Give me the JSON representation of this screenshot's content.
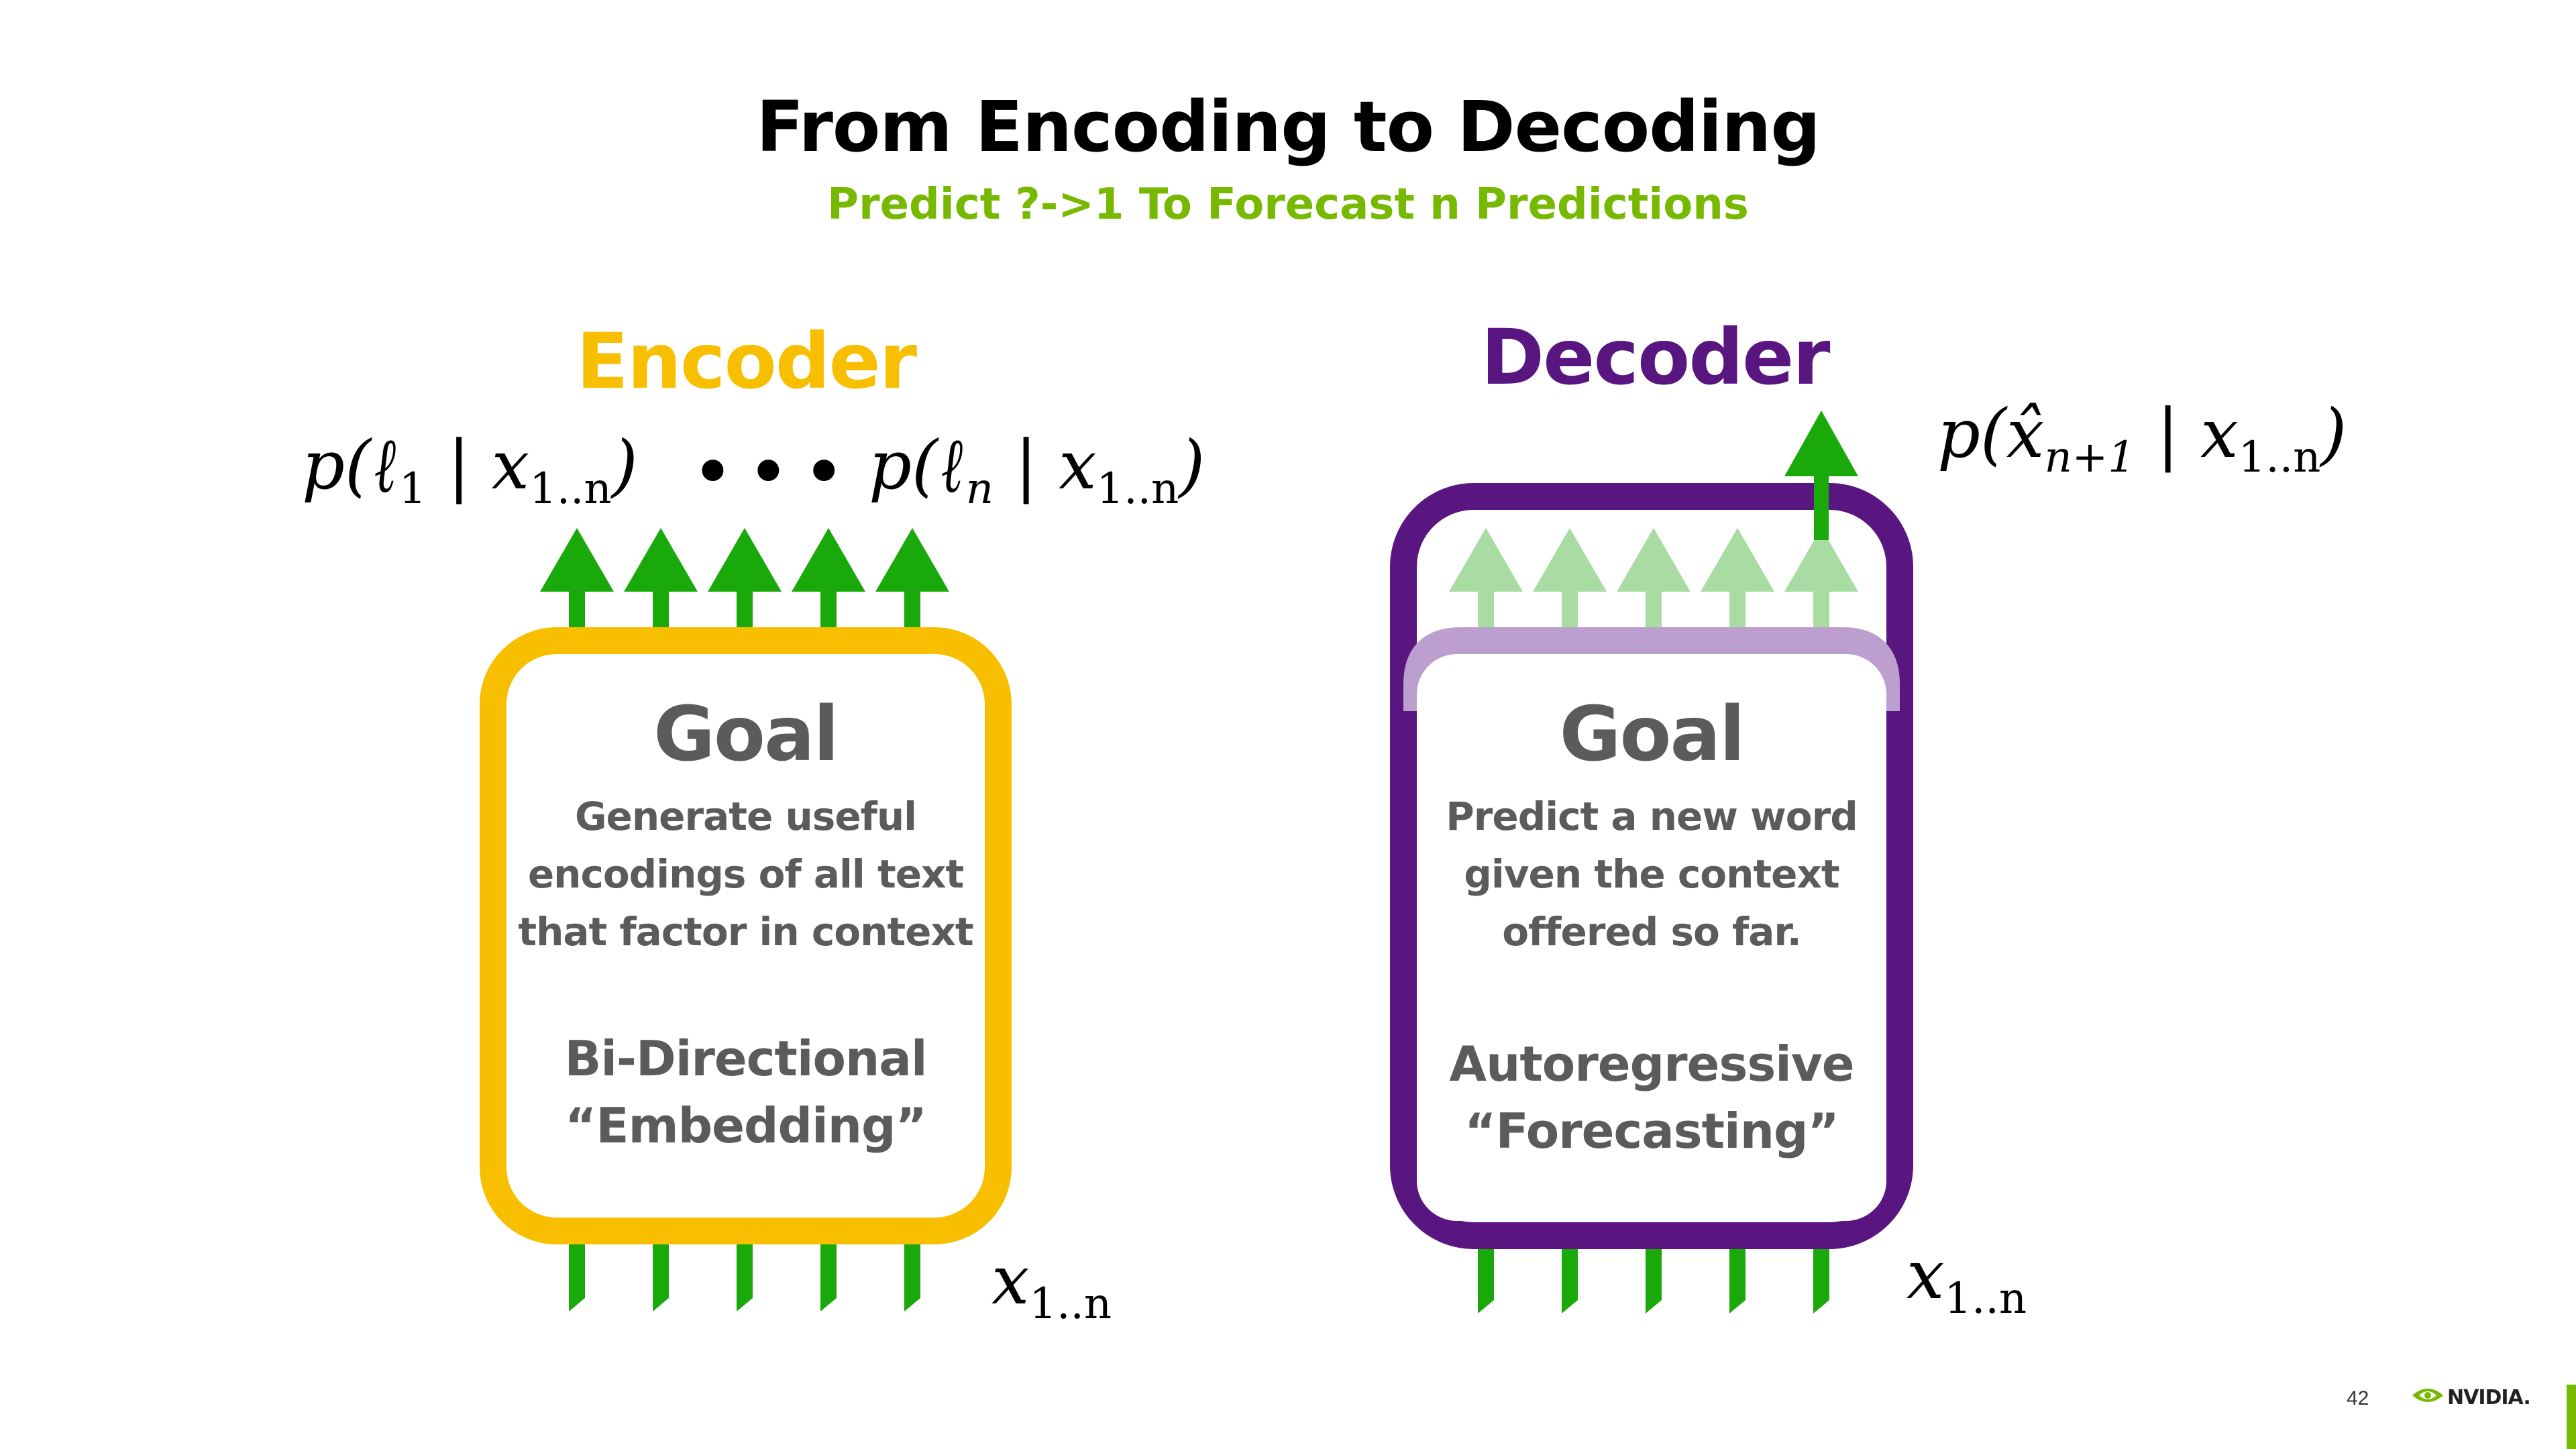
{
  "title": "From Encoding to Decoding",
  "subtitle": "Predict ?->1 To Forecast n Predictions",
  "colors": {
    "encoder": "#f8bf00",
    "decoder": "#5a1680",
    "decoder_inner": "#bd9fcf",
    "arrow": "#1aa90a",
    "arrow_faded": "#a8dca2",
    "text_gray": "#5b5b5b",
    "accent": "#76b900"
  },
  "encoder": {
    "heading": "Encoder",
    "goal": "Goal",
    "description": [
      "Generate useful",
      "encodings of all text",
      "that factor in context"
    ],
    "mode": [
      "Bi-Directional",
      "“Embedding”"
    ],
    "output_first": {
      "p": "p(",
      "sym": "ℓ",
      "sub": "1",
      "bar": " | x",
      "xsub": "1..n",
      "close": ")"
    },
    "output_last": {
      "p": "p(",
      "sym": "ℓ",
      "sub": "n",
      "bar": " | x",
      "xsub": "1..n",
      "close": ")"
    },
    "ellipsis": "•••",
    "input": {
      "x": "x",
      "sub": "1..n"
    }
  },
  "decoder": {
    "heading": "Decoder",
    "goal": "Goal",
    "description": [
      "Predict a new word",
      "given the context",
      "offered so far."
    ],
    "mode": [
      "Autoregressive",
      "“Forecasting”"
    ],
    "output": {
      "p": "p(",
      "sym": "x̂",
      "sub": "n+1",
      "bar": " | x",
      "xsub": "1..n",
      "close": ")"
    },
    "input": {
      "x": "x",
      "sub": "1..n"
    }
  },
  "footer": {
    "page_number": "42",
    "logo_text": "NVIDIA.",
    "logo_icon": "nvidia-eye-icon"
  }
}
